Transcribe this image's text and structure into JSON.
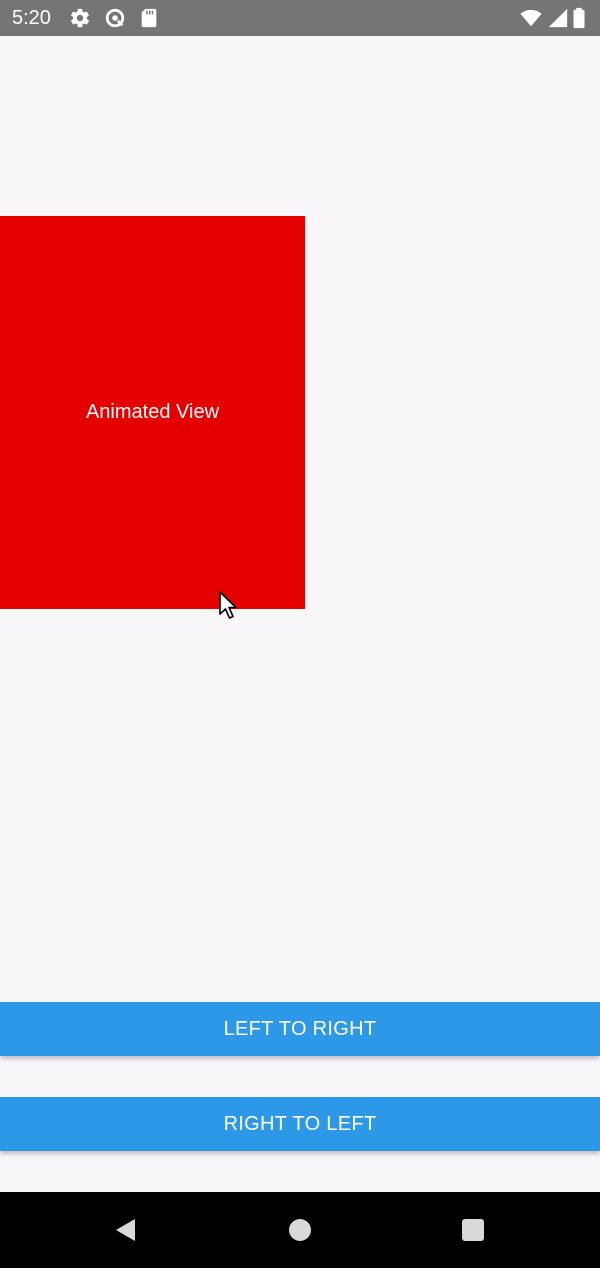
{
  "status_bar": {
    "time": "5:20",
    "left_icons": [
      "settings-icon",
      "data-saver-icon",
      "sd-card-icon"
    ],
    "right_icons": [
      "wifi-icon",
      "signal-icon",
      "battery-icon"
    ],
    "background": "#757575"
  },
  "main": {
    "animated_view": {
      "label": "Animated View",
      "color": "#e50000"
    }
  },
  "buttons": {
    "left_to_right": "LEFT TO RIGHT",
    "right_to_left": "RIGHT TO LEFT",
    "color": "#2e98e8"
  },
  "nav_bar": {
    "icons": [
      "back-icon",
      "home-icon",
      "recents-icon"
    ]
  }
}
